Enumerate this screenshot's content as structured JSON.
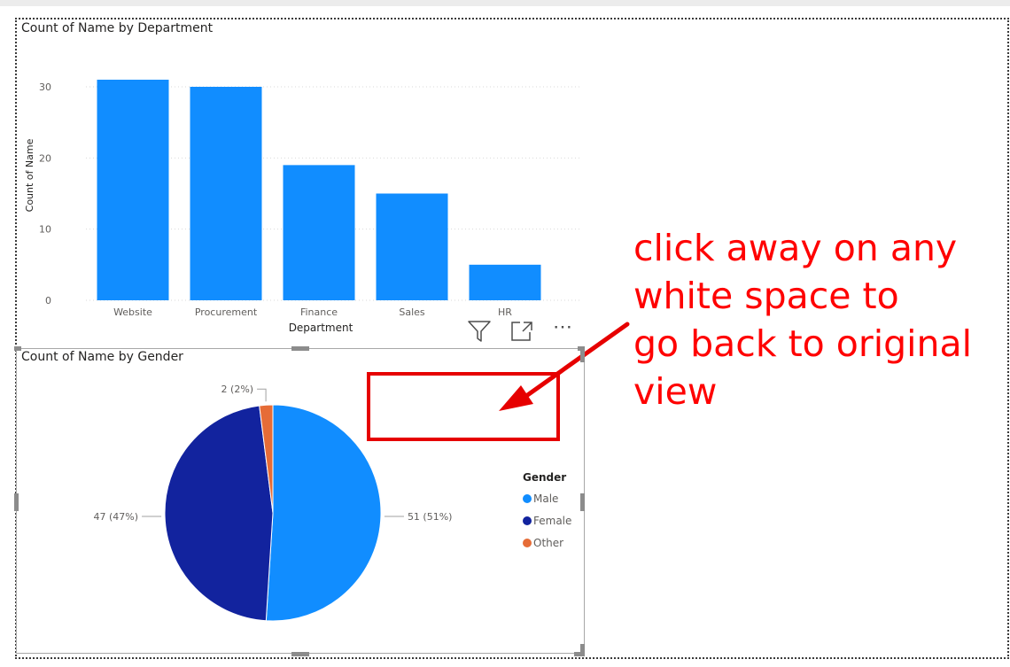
{
  "bar_visual": {
    "title": "Count of Name by Department"
  },
  "pie_visual": {
    "title": "Count of Name by Gender"
  },
  "annotation": {
    "lines": [
      "click away on any",
      "white space to",
      "go back to original",
      "view"
    ],
    "color": "#ff0000"
  },
  "toolbar": {
    "filter_icon": "filter-icon",
    "focus_icon": "focus-mode-icon",
    "more_options": "⋯"
  },
  "chart_data": [
    {
      "type": "bar",
      "title": "Count of Name by Department",
      "categories": [
        "Website",
        "Procurement",
        "Finance",
        "Sales",
        "HR"
      ],
      "series": [
        {
          "values": [
            31,
            30,
            19,
            15,
            5
          ],
          "color": "#118dff"
        }
      ],
      "xlabel": "Department",
      "ylabel": "Count of Name",
      "ylim": [
        0,
        32
      ],
      "yticks": [
        0,
        10,
        20,
        30
      ],
      "grid": "dotted horizontal",
      "legend": "none"
    },
    {
      "type": "pie",
      "title": "Count of Name by Gender",
      "legend_title": "Gender",
      "legend": "right",
      "slices": [
        {
          "label": "Male",
          "value": 51,
          "percent": "51%",
          "data_label": "51 (51%)",
          "color": "#118dff"
        },
        {
          "label": "Female",
          "value": 47,
          "percent": "47%",
          "data_label": "47 (47%)",
          "color": "#12239e"
        },
        {
          "label": "Other",
          "value": 2,
          "percent": "2%",
          "data_label": "2 (2%)",
          "color": "#e66c37"
        }
      ]
    }
  ]
}
